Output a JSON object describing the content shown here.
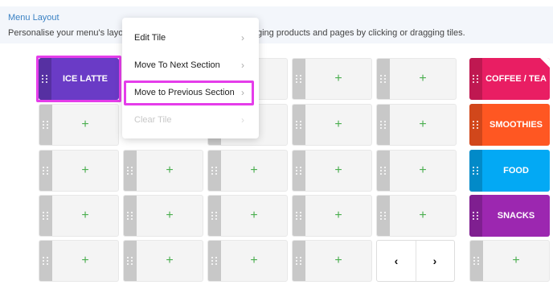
{
  "header": {
    "title": "Menu Layout",
    "description_left": "Personalise your menu's layout",
    "description_right": "ging products and pages by clicking or dragging tiles."
  },
  "tiles": {
    "active_tile_label": "ICE LATTE",
    "empty_label": "+",
    "handle_icon": "drag-handle-icon"
  },
  "context_menu": {
    "items": [
      {
        "label": "Edit Tile",
        "enabled": true
      },
      {
        "label": "Move To Next Section",
        "enabled": true
      },
      {
        "label": "Move to Previous Section",
        "enabled": true
      },
      {
        "label": "Clear Tile",
        "enabled": false
      }
    ],
    "chevron": "›"
  },
  "categories": [
    {
      "label": "COFFEE / TEA",
      "color": "#e91e63"
    },
    {
      "label": "SMOOTHIES",
      "color": "#ff5722"
    },
    {
      "label": "FOOD",
      "color": "#03a9f4"
    },
    {
      "label": "SNACKS",
      "color": "#9c27b0"
    }
  ],
  "pager": {
    "prev": "‹",
    "next": "›"
  },
  "colors": {
    "active_tile": "#6a3bc6",
    "highlight": "#e53dea",
    "plus": "#4caf50"
  }
}
